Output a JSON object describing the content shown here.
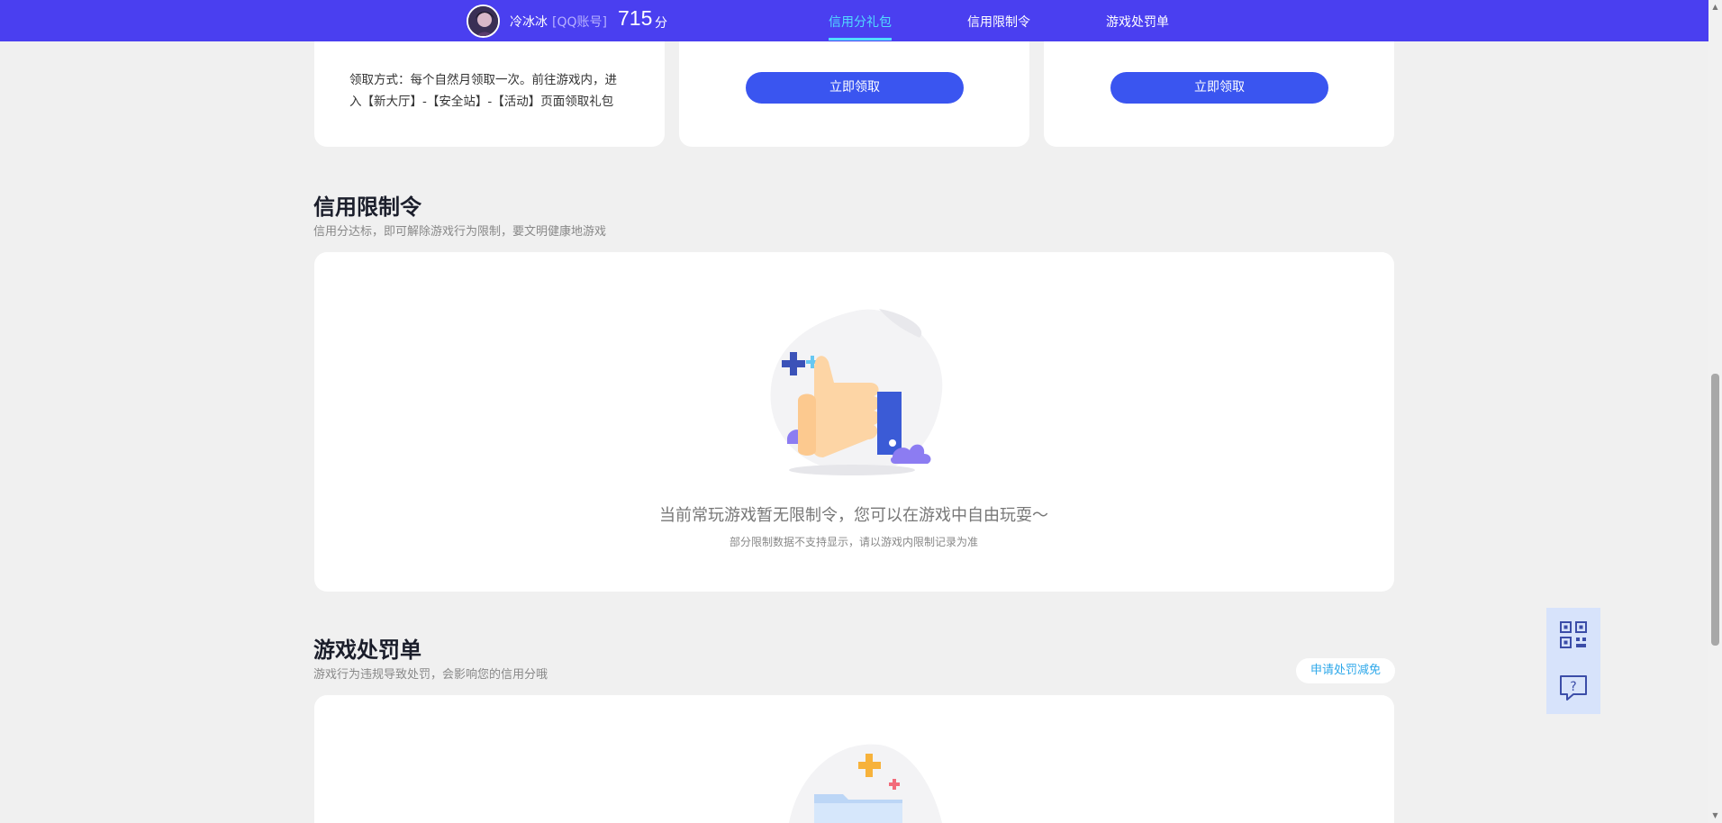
{
  "topbar": {
    "user_name": "冷冰冰",
    "account_type": "[QQ账号]",
    "score": "715",
    "score_unit": "分",
    "tabs": [
      {
        "label": "信用分礼包",
        "active": true
      },
      {
        "label": "信用限制令",
        "active": false
      },
      {
        "label": "游戏处罚单",
        "active": false
      }
    ]
  },
  "gift_cards": {
    "desc_line1": "领取方式：每个自然月领取一次。前往游戏内，进",
    "desc_line2": "入【新大厅】-【安全站】-【活动】页面领取礼包",
    "claim_label_1": "立即领取",
    "claim_label_2": "立即领取"
  },
  "restriction": {
    "title": "信用限制令",
    "subtitle": "信用分达标，即可解除游戏行为限制，要文明健康地游戏",
    "empty_main": "当前常玩游戏暂无限制令，您可以在游戏中自由玩耍～",
    "empty_sub": "部分限制数据不支持显示，请以游戏内限制记录为准"
  },
  "penalty": {
    "title": "游戏处罚单",
    "subtitle": "游戏行为违规导致处罚，会影响您的信用分哦",
    "apply_label": "申请处罚减免"
  },
  "side": {
    "qr_icon": "qr-code-icon",
    "help_icon": "help-chat-icon"
  },
  "colors": {
    "topbar": "#4a3ff0",
    "accent_tab": "#51dcff",
    "button": "#3a55f0",
    "apply_text": "#2ea8ea"
  }
}
